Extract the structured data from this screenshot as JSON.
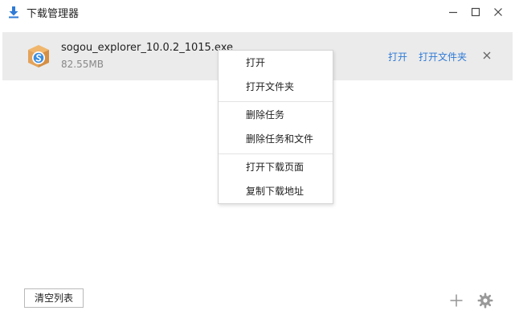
{
  "window": {
    "title": "下载管理器",
    "controls": [
      "minimize-icon",
      "maximize-icon",
      "close-icon"
    ]
  },
  "download": {
    "file_name": "sogou_explorer_10.0.2_1015.exe",
    "file_size": "82.55MB",
    "icon": "package-icon",
    "actions": {
      "open": "打开",
      "open_folder": "打开文件夹"
    }
  },
  "context_menu": {
    "items": [
      {
        "label": "打开"
      },
      {
        "label": "打开文件夹"
      },
      {
        "label": "删除任务"
      },
      {
        "label": "删除任务和文件"
      },
      {
        "label": "打开下载页面"
      },
      {
        "label": "复制下载地址"
      }
    ]
  },
  "footer": {
    "clear_label": "清空列表",
    "icons": [
      "add-icon",
      "settings-icon"
    ]
  },
  "colors": {
    "accent": "#2f7ad6",
    "row_bg": "#ebebeb",
    "package": "#e3a35a"
  }
}
